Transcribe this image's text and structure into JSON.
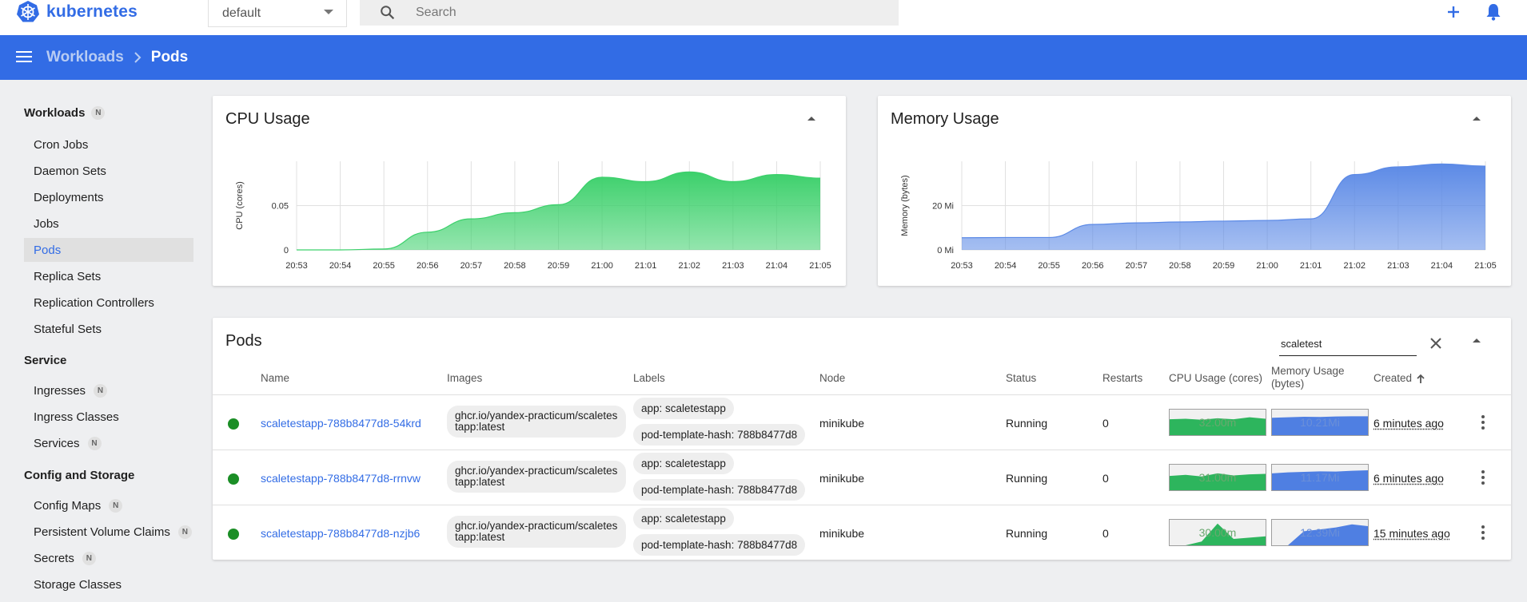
{
  "app": {
    "name": "kubernetes"
  },
  "namespace": {
    "selected": "default"
  },
  "search": {
    "placeholder": "Search"
  },
  "breadcrumb": {
    "parent": "Workloads",
    "current": "Pods"
  },
  "sidebar": {
    "sections": [
      {
        "label": "Workloads",
        "badge": "N"
      },
      {
        "label": "Service"
      },
      {
        "label": "Config and Storage"
      }
    ],
    "items": [
      {
        "label": "Cron Jobs"
      },
      {
        "label": "Daemon Sets"
      },
      {
        "label": "Deployments"
      },
      {
        "label": "Jobs"
      },
      {
        "label": "Pods",
        "active": true
      },
      {
        "label": "Replica Sets"
      },
      {
        "label": "Replication Controllers"
      },
      {
        "label": "Stateful Sets"
      },
      {
        "label": "Ingresses",
        "badge": "N"
      },
      {
        "label": "Ingress Classes"
      },
      {
        "label": "Services",
        "badge": "N"
      },
      {
        "label": "Config Maps",
        "badge": "N"
      },
      {
        "label": "Persistent Volume Claims",
        "badge": "N"
      },
      {
        "label": "Secrets",
        "badge": "N"
      },
      {
        "label": "Storage Classes"
      }
    ]
  },
  "cpu_card": {
    "title": "CPU Usage"
  },
  "memory_card": {
    "title": "Memory Usage"
  },
  "chart_data": [
    {
      "type": "area",
      "title": "CPU Usage",
      "ylabel": "CPU (cores)",
      "x": [
        "20:53",
        "20:54",
        "20:55",
        "20:56",
        "20:57",
        "20:58",
        "20:59",
        "21:00",
        "21:01",
        "21:02",
        "21:03",
        "21:04",
        "21:05"
      ],
      "yticks": [
        "0",
        "0.05"
      ],
      "ylim": [
        0,
        0.1
      ],
      "grid": true,
      "color": "#3cd06b",
      "series": [
        {
          "values": [
            0,
            0,
            0.001,
            0.02,
            0.035,
            0.042,
            0.051,
            0.082,
            0.077,
            0.088,
            0.077,
            0.085,
            0.081
          ]
        }
      ]
    },
    {
      "type": "area",
      "title": "Memory Usage",
      "ylabel": "Memory (bytes)",
      "x": [
        "20:53",
        "20:54",
        "20:55",
        "20:56",
        "20:57",
        "20:58",
        "20:59",
        "21:00",
        "21:01",
        "21:02",
        "21:03",
        "21:04",
        "21:05"
      ],
      "yticks": [
        "0 Mi",
        "20 Mi"
      ],
      "ylim": [
        0,
        40
      ],
      "grid": true,
      "color": "#5c8ae6",
      "series": [
        {
          "values": [
            5.5,
            5.6,
            5.6,
            11.5,
            12.2,
            12.6,
            13.0,
            13.3,
            14.0,
            34.0,
            37.5,
            38.8,
            37.8
          ]
        }
      ]
    }
  ],
  "pods": {
    "title": "Pods",
    "filter_value": "scaletest",
    "columns": {
      "name": "Name",
      "images": "Images",
      "labels": "Labels",
      "node": "Node",
      "status": "Status",
      "restarts": "Restarts",
      "cpu": "CPU Usage (cores)",
      "memory": "Memory Usage (bytes)",
      "created": "Created"
    },
    "rows": [
      {
        "name": "scaletestapp-788b8477d8-54krd",
        "image": "ghcr.io/yandex-practicum/scaletestapp:latest",
        "label_app": "app: scaletestapp",
        "label_hash": "pod-template-hash: 788b8477d8",
        "node": "minikube",
        "status": "Running",
        "restarts": "0",
        "cpu": "32.00m",
        "memory": "10.21Mi",
        "created": "6 minutes ago",
        "cpu_spark": [
          0.62,
          0.64,
          0.6,
          0.66,
          0.62,
          0.7,
          0.64
        ],
        "mem_spark": [
          0.68,
          0.7,
          0.72,
          0.71,
          0.73,
          0.74,
          0.74
        ]
      },
      {
        "name": "scaletestapp-788b8477d8-rrnvw",
        "image": "ghcr.io/yandex-practicum/scaletestapp:latest",
        "label_app": "app: scaletestapp",
        "label_hash": "pod-template-hash: 788b8477d8",
        "node": "minikube",
        "status": "Running",
        "restarts": "0",
        "cpu": "31.00m",
        "memory": "11.17Mi",
        "created": "6 minutes ago",
        "cpu_spark": [
          0.56,
          0.6,
          0.54,
          0.66,
          0.58,
          0.62,
          0.64
        ],
        "mem_spark": [
          0.66,
          0.7,
          0.72,
          0.74,
          0.73,
          0.76,
          0.78
        ]
      },
      {
        "name": "scaletestapp-788b8477d8-nzjb6",
        "image": "ghcr.io/yandex-practicum/scaletestapp:latest",
        "label_app": "app: scaletestapp",
        "label_hash": "pod-template-hash: 788b8477d8",
        "node": "minikube",
        "status": "Running",
        "restarts": "0",
        "cpu": "30.00m",
        "memory": "12.39Mi",
        "created": "15 minutes ago",
        "cpu_spark": [
          0.0,
          0.0,
          0.15,
          0.85,
          0.25,
          0.3,
          0.35
        ],
        "mem_spark": [
          0.0,
          0.0,
          0.55,
          0.62,
          0.7,
          0.82,
          0.75
        ]
      }
    ]
  },
  "colors": {
    "brand": "#326ce5",
    "running": "#1b8e26",
    "cpu": "#2db55d",
    "memory": "#4f7fe2"
  }
}
